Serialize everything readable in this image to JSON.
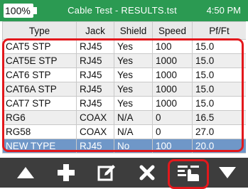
{
  "status_bar": {
    "battery": "100%",
    "title": "Cable Test - RESULTS.tst",
    "time": "4:50 PM"
  },
  "table": {
    "headers": [
      "Type",
      "Jack",
      "Shield",
      "Speed",
      "Pf/Ft"
    ],
    "rows": [
      [
        "CAT5 STP",
        "RJ45",
        "Yes",
        "100",
        "15.0"
      ],
      [
        "CAT5E STP",
        "RJ45",
        "Yes",
        "1000",
        "15.0"
      ],
      [
        "CAT6 STP",
        "RJ45",
        "Yes",
        "1000",
        "15.0"
      ],
      [
        "CAT6A STP",
        "RJ45",
        "Yes",
        "1000",
        "15.0"
      ],
      [
        "CAT7 STP",
        "RJ45",
        "Yes",
        "1000",
        "15.0"
      ],
      [
        "RG6",
        "COAX",
        "N/A",
        "0",
        "16.5"
      ],
      [
        "RG58",
        "COAX",
        "N/A",
        "0",
        "27.0"
      ],
      [
        "NEW TYPE",
        "RJ45",
        "No",
        "100",
        "20.0"
      ]
    ],
    "selected_row_index": 7
  },
  "toolbar": {
    "icons": [
      "up-arrow-icon",
      "plus-icon",
      "edit-icon",
      "delete-x-icon",
      "edit-list-icon",
      "down-arrow-icon"
    ]
  },
  "colors": {
    "status_bar_bg": "#2b9a52",
    "toolbar_bg": "#3d3d3d",
    "selected_row_bg": "#6f97c8",
    "highlight_red": "#e3181c"
  }
}
